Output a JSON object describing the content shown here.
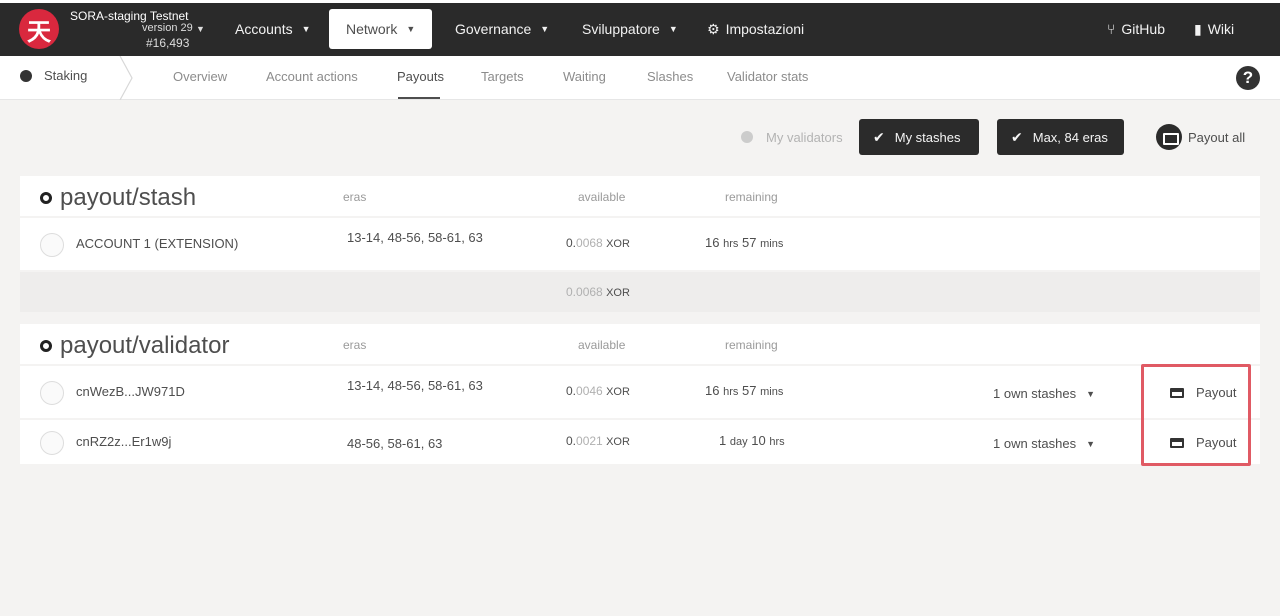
{
  "header": {
    "chain_name": "SORA-staging Testnet",
    "version": "version 29",
    "block": "#16,493",
    "logo_glyph": "天",
    "menu": [
      {
        "label": "Accounts"
      },
      {
        "label": "Network"
      },
      {
        "label": "Governance"
      },
      {
        "label": "Sviluppatore"
      },
      {
        "label": "Impostazioni"
      }
    ],
    "github": "GitHub",
    "wiki": "Wiki"
  },
  "subnav": {
    "section": "Staking",
    "tabs": [
      "Overview",
      "Account actions",
      "Payouts",
      "Targets",
      "Waiting",
      "Slashes",
      "Validator stats"
    ],
    "active_tab": "Payouts"
  },
  "toolbar": {
    "my_validators": "My validators",
    "my_stashes": "My stashes",
    "max_eras": "Max, 84 eras",
    "payout_all": "Payout all"
  },
  "stash_table": {
    "title": "payout/stash",
    "col_eras": "eras",
    "col_available": "available",
    "col_remaining": "remaining",
    "rows": [
      {
        "account": "ACCOUNT 1 (EXTENSION)",
        "eras": "13-14, 48-56, 58-61, 63",
        "amount_int": "0.",
        "amount_frac": "0068",
        "unit": "XOR",
        "rem_a": "16",
        "rem_a_unit": "hrs",
        "rem_b": "57",
        "rem_b_unit": "mins"
      }
    ],
    "total": {
      "amount_int": "0.",
      "amount_frac": "0068",
      "unit": "XOR"
    }
  },
  "validator_table": {
    "title": "payout/validator",
    "col_eras": "eras",
    "col_available": "available",
    "col_remaining": "remaining",
    "rows": [
      {
        "account": "cnWezB...JW971D",
        "eras": "13-14, 48-56, 58-61, 63",
        "amount_int": "0.",
        "amount_frac": "0046",
        "unit": "XOR",
        "rem_a": "16",
        "rem_a_unit": "hrs",
        "rem_b": "57",
        "rem_b_unit": "mins",
        "stashes": "1 own stashes",
        "payout": "Payout"
      },
      {
        "account": "cnRZ2z...Er1w9j",
        "eras": "48-56, 58-61, 63",
        "amount_int": "0.",
        "amount_frac": "0021",
        "unit": "XOR",
        "rem_a": "1",
        "rem_a_unit": "day",
        "rem_b": "10",
        "rem_b_unit": "hrs",
        "stashes": "1 own stashes",
        "payout": "Payout"
      }
    ]
  },
  "help_glyph": "?"
}
